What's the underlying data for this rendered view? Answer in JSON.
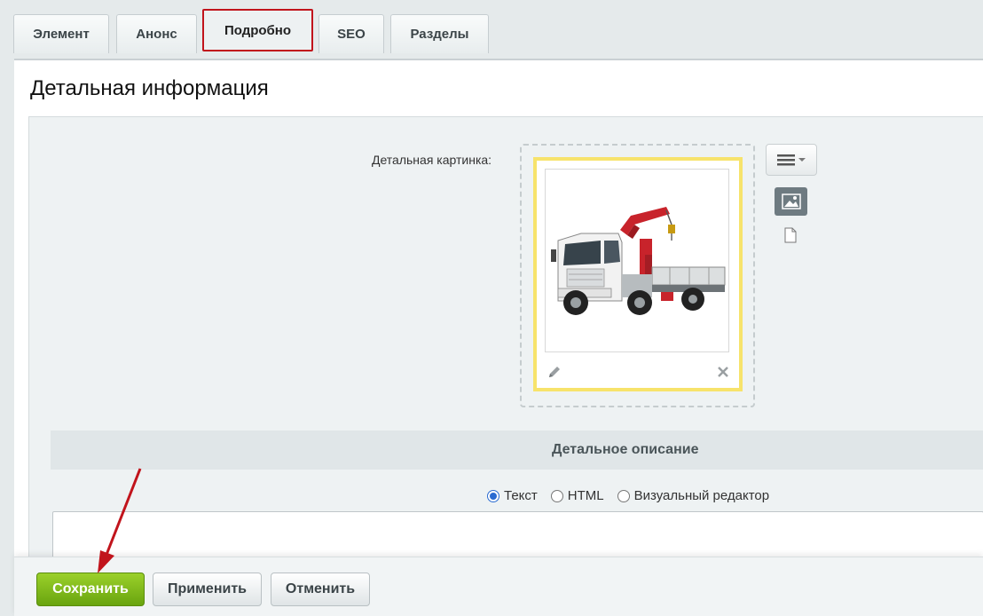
{
  "tabs": [
    {
      "label": "Элемент"
    },
    {
      "label": "Анонс"
    },
    {
      "label": "Подробно",
      "active": true
    },
    {
      "label": "SEO"
    },
    {
      "label": "Разделы"
    }
  ],
  "section": {
    "title": "Детальная информация",
    "picture_label": "Детальная картинка:",
    "description_title": "Детальное описание"
  },
  "editor_modes": [
    {
      "label": "Текст",
      "checked": true
    },
    {
      "label": "HTML",
      "checked": false
    },
    {
      "label": "Визуальный редактор",
      "checked": false
    }
  ],
  "buttons": {
    "save": "Сохранить",
    "apply": "Применить",
    "cancel": "Отменить"
  },
  "icons": {
    "menu": "hamburger-menu-icon",
    "image_mode": "image-icon",
    "file_mode": "file-icon",
    "edit": "pencil-icon",
    "delete": "close-icon"
  },
  "colors": {
    "accent_red": "#c1141c",
    "save_green": "#7ab51d",
    "highlight_yellow": "#f7e36b",
    "radio_blue": "#2a6bd1"
  }
}
